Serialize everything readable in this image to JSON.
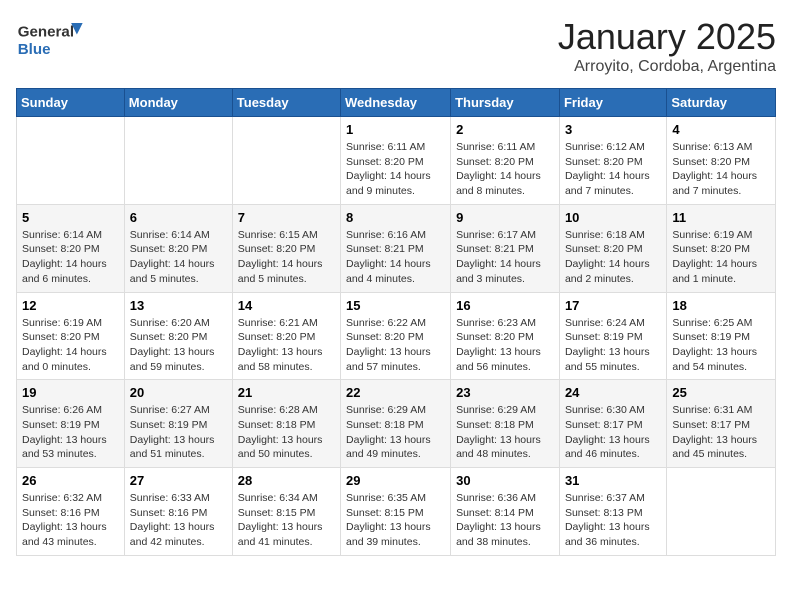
{
  "header": {
    "logo_general": "General",
    "logo_blue": "Blue",
    "title": "January 2025",
    "subtitle": "Arroyito, Cordoba, Argentina"
  },
  "weekdays": [
    "Sunday",
    "Monday",
    "Tuesday",
    "Wednesday",
    "Thursday",
    "Friday",
    "Saturday"
  ],
  "weeks": [
    [
      {
        "day": "",
        "info": ""
      },
      {
        "day": "",
        "info": ""
      },
      {
        "day": "",
        "info": ""
      },
      {
        "day": "1",
        "info": "Sunrise: 6:11 AM\nSunset: 8:20 PM\nDaylight: 14 hours and 9 minutes."
      },
      {
        "day": "2",
        "info": "Sunrise: 6:11 AM\nSunset: 8:20 PM\nDaylight: 14 hours and 8 minutes."
      },
      {
        "day": "3",
        "info": "Sunrise: 6:12 AM\nSunset: 8:20 PM\nDaylight: 14 hours and 7 minutes."
      },
      {
        "day": "4",
        "info": "Sunrise: 6:13 AM\nSunset: 8:20 PM\nDaylight: 14 hours and 7 minutes."
      }
    ],
    [
      {
        "day": "5",
        "info": "Sunrise: 6:14 AM\nSunset: 8:20 PM\nDaylight: 14 hours and 6 minutes."
      },
      {
        "day": "6",
        "info": "Sunrise: 6:14 AM\nSunset: 8:20 PM\nDaylight: 14 hours and 5 minutes."
      },
      {
        "day": "7",
        "info": "Sunrise: 6:15 AM\nSunset: 8:20 PM\nDaylight: 14 hours and 5 minutes."
      },
      {
        "day": "8",
        "info": "Sunrise: 6:16 AM\nSunset: 8:21 PM\nDaylight: 14 hours and 4 minutes."
      },
      {
        "day": "9",
        "info": "Sunrise: 6:17 AM\nSunset: 8:21 PM\nDaylight: 14 hours and 3 minutes."
      },
      {
        "day": "10",
        "info": "Sunrise: 6:18 AM\nSunset: 8:20 PM\nDaylight: 14 hours and 2 minutes."
      },
      {
        "day": "11",
        "info": "Sunrise: 6:19 AM\nSunset: 8:20 PM\nDaylight: 14 hours and 1 minute."
      }
    ],
    [
      {
        "day": "12",
        "info": "Sunrise: 6:19 AM\nSunset: 8:20 PM\nDaylight: 14 hours and 0 minutes."
      },
      {
        "day": "13",
        "info": "Sunrise: 6:20 AM\nSunset: 8:20 PM\nDaylight: 13 hours and 59 minutes."
      },
      {
        "day": "14",
        "info": "Sunrise: 6:21 AM\nSunset: 8:20 PM\nDaylight: 13 hours and 58 minutes."
      },
      {
        "day": "15",
        "info": "Sunrise: 6:22 AM\nSunset: 8:20 PM\nDaylight: 13 hours and 57 minutes."
      },
      {
        "day": "16",
        "info": "Sunrise: 6:23 AM\nSunset: 8:20 PM\nDaylight: 13 hours and 56 minutes."
      },
      {
        "day": "17",
        "info": "Sunrise: 6:24 AM\nSunset: 8:19 PM\nDaylight: 13 hours and 55 minutes."
      },
      {
        "day": "18",
        "info": "Sunrise: 6:25 AM\nSunset: 8:19 PM\nDaylight: 13 hours and 54 minutes."
      }
    ],
    [
      {
        "day": "19",
        "info": "Sunrise: 6:26 AM\nSunset: 8:19 PM\nDaylight: 13 hours and 53 minutes."
      },
      {
        "day": "20",
        "info": "Sunrise: 6:27 AM\nSunset: 8:19 PM\nDaylight: 13 hours and 51 minutes."
      },
      {
        "day": "21",
        "info": "Sunrise: 6:28 AM\nSunset: 8:18 PM\nDaylight: 13 hours and 50 minutes."
      },
      {
        "day": "22",
        "info": "Sunrise: 6:29 AM\nSunset: 8:18 PM\nDaylight: 13 hours and 49 minutes."
      },
      {
        "day": "23",
        "info": "Sunrise: 6:29 AM\nSunset: 8:18 PM\nDaylight: 13 hours and 48 minutes."
      },
      {
        "day": "24",
        "info": "Sunrise: 6:30 AM\nSunset: 8:17 PM\nDaylight: 13 hours and 46 minutes."
      },
      {
        "day": "25",
        "info": "Sunrise: 6:31 AM\nSunset: 8:17 PM\nDaylight: 13 hours and 45 minutes."
      }
    ],
    [
      {
        "day": "26",
        "info": "Sunrise: 6:32 AM\nSunset: 8:16 PM\nDaylight: 13 hours and 43 minutes."
      },
      {
        "day": "27",
        "info": "Sunrise: 6:33 AM\nSunset: 8:16 PM\nDaylight: 13 hours and 42 minutes."
      },
      {
        "day": "28",
        "info": "Sunrise: 6:34 AM\nSunset: 8:15 PM\nDaylight: 13 hours and 41 minutes."
      },
      {
        "day": "29",
        "info": "Sunrise: 6:35 AM\nSunset: 8:15 PM\nDaylight: 13 hours and 39 minutes."
      },
      {
        "day": "30",
        "info": "Sunrise: 6:36 AM\nSunset: 8:14 PM\nDaylight: 13 hours and 38 minutes."
      },
      {
        "day": "31",
        "info": "Sunrise: 6:37 AM\nSunset: 8:13 PM\nDaylight: 13 hours and 36 minutes."
      },
      {
        "day": "",
        "info": ""
      }
    ]
  ]
}
